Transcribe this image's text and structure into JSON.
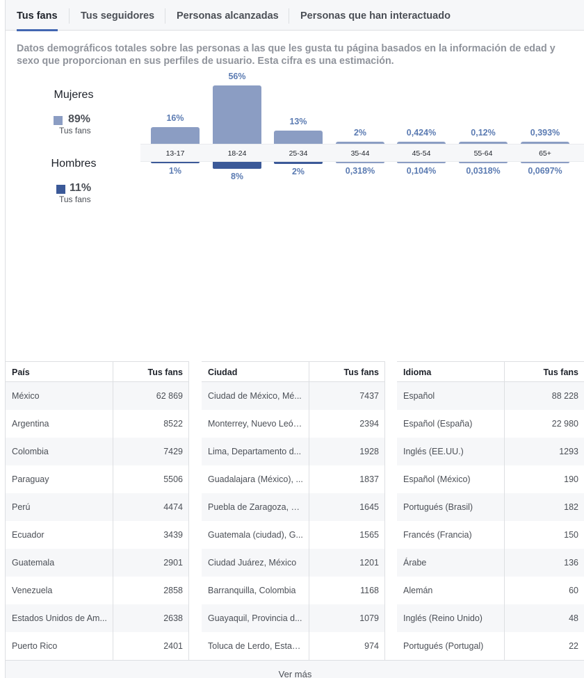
{
  "tabs": [
    "Tus fans",
    "Tus seguidores",
    "Personas alcanzadas",
    "Personas que han interactuado"
  ],
  "description": "Datos demográficos totales sobre las personas a las que les gusta tu página basados en la información de edad y sexo que proporcionan en sus perfiles de usuario. Esta cifra es una estimación.",
  "gender": {
    "women": {
      "title": "Mujeres",
      "pct": "89%",
      "sub": "Tus fans",
      "color": "#8b9dc3"
    },
    "men": {
      "title": "Hombres",
      "pct": "11%",
      "sub": "Tus fans",
      "color": "#3b5998"
    }
  },
  "chart_data": {
    "type": "bar",
    "categories": [
      "13-17",
      "18-24",
      "25-34",
      "35-44",
      "45-54",
      "55-64",
      "65+"
    ],
    "series": [
      {
        "name": "Mujeres",
        "values": [
          16,
          56,
          13,
          2,
          0.424,
          0.12,
          0.393
        ],
        "labels": [
          "16%",
          "56%",
          "13%",
          "2%",
          "0,424%",
          "0,12%",
          "0,393%"
        ]
      },
      {
        "name": "Hombres",
        "values": [
          1,
          8,
          2,
          0.318,
          0.104,
          0.0318,
          0.0697
        ],
        "labels": [
          "1%",
          "8%",
          "2%",
          "0,318%",
          "0,104%",
          "0,0318%",
          "0,0697%"
        ]
      }
    ]
  },
  "tables": [
    {
      "col1": "País",
      "col2": "Tus fans",
      "rows": [
        [
          "México",
          "62 869"
        ],
        [
          "Argentina",
          "8522"
        ],
        [
          "Colombia",
          "7429"
        ],
        [
          "Paraguay",
          "5506"
        ],
        [
          "Perú",
          "4474"
        ],
        [
          "Ecuador",
          "3439"
        ],
        [
          "Guatemala",
          "2901"
        ],
        [
          "Venezuela",
          "2858"
        ],
        [
          "Estados Unidos de Am...",
          "2638"
        ],
        [
          "Puerto Rico",
          "2401"
        ]
      ]
    },
    {
      "col1": "Ciudad",
      "col2": "Tus fans",
      "rows": [
        [
          "Ciudad de México, Mé...",
          "7437"
        ],
        [
          "Monterrey, Nuevo León...",
          "2394"
        ],
        [
          "Lima, Departamento d...",
          "1928"
        ],
        [
          "Guadalajara (México), ...",
          "1837"
        ],
        [
          "Puebla de Zaragoza, M...",
          "1645"
        ],
        [
          "Guatemala (ciudad), G...",
          "1565"
        ],
        [
          "Ciudad Juárez, México",
          "1201"
        ],
        [
          "Barranquilla, Colombia",
          "1168"
        ],
        [
          "Guayaquil, Provincia d...",
          "1079"
        ],
        [
          "Toluca de Lerdo, Estad...",
          "974"
        ]
      ]
    },
    {
      "col1": "Idioma",
      "col2": "Tus fans",
      "rows": [
        [
          "Español",
          "88 228"
        ],
        [
          "Español (España)",
          "22 980"
        ],
        [
          "Inglés (EE.UU.)",
          "1293"
        ],
        [
          "Español (México)",
          "190"
        ],
        [
          "Portugués (Brasil)",
          "182"
        ],
        [
          "Francés (Francia)",
          "150"
        ],
        [
          "Árabe",
          "136"
        ],
        [
          "Alemán",
          "60"
        ],
        [
          "Inglés (Reino Unido)",
          "48"
        ],
        [
          "Portugués (Portugal)",
          "22"
        ]
      ]
    }
  ],
  "more_label": "Ver más"
}
